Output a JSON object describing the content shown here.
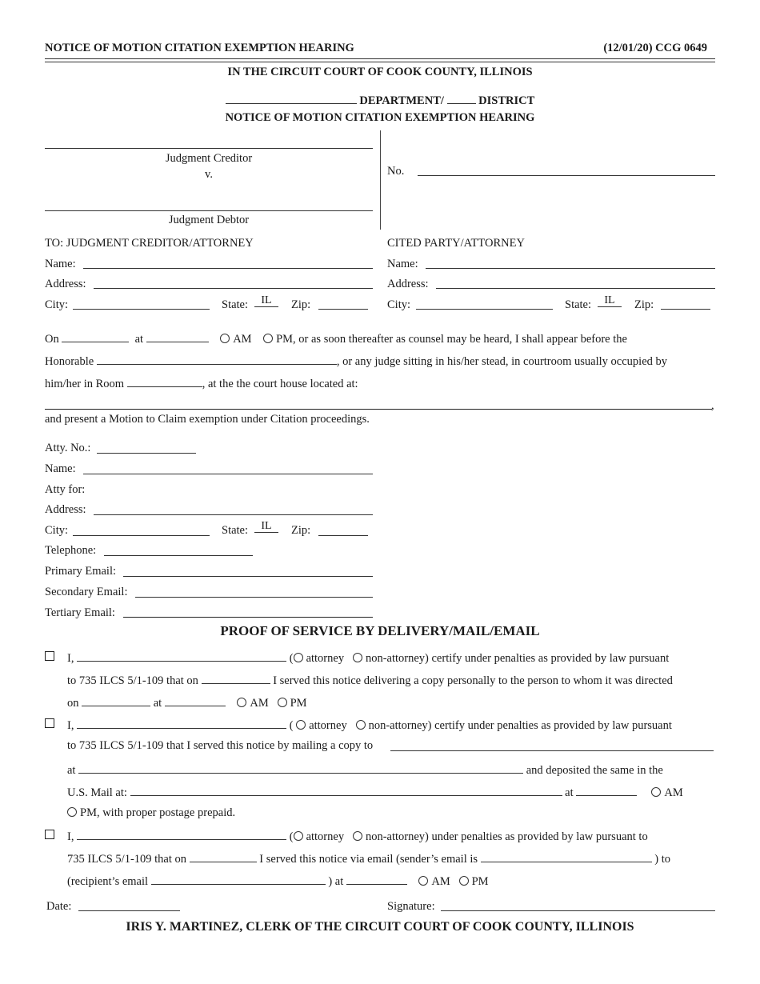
{
  "header": {
    "title_left": "NOTICE OF MOTION CITATION EXEMPTION HEARING",
    "title_right": "(12/01/20) CCG 0649"
  },
  "court": {
    "name": "IN THE CIRCUIT COURT OF COOK COUNTY, ILLINOIS",
    "department_label": "DEPARTMENT/",
    "district_label": "DISTRICT",
    "form_title": "NOTICE OF MOTION CITATION EXEMPTION HEARING"
  },
  "caption": {
    "creditor_label": "Judgment Creditor",
    "versus": "v.",
    "debtor_label": "Judgment Debtor",
    "case_no_label": "No.",
    "case_no_value": ""
  },
  "to_section": {
    "left_heading": "TO:  JUDGMENT CREDITOR/ATTORNEY",
    "right_heading": "CITED PARTY/ATTORNEY",
    "name_label": "Name:",
    "address_label": "Address:",
    "city_label": "City:",
    "state_label": "State:",
    "state_value": "IL",
    "zip_label": "Zip:"
  },
  "hearing": {
    "on_label": "On",
    "at_label": "at",
    "am_label": "AM",
    "pm_text": "PM, or as soon thereafter as counsel may be heard, I shall appear before the",
    "honorable_label": "Honorable",
    "honorable_suffix": ", or any judge sitting in his/her stead, in courtroom usually occupied by",
    "room_label": "him/her in Room",
    "room_suffix": ", at the the court house located at:",
    "address_suffix": ",",
    "motion_text": "and present a Motion to Claim exemption under Citation proceedings."
  },
  "attorney": {
    "atty_no_label": "Atty. No.:",
    "name_label": "Name:",
    "atty_for_label": "Atty for:",
    "address_label": "Address:",
    "city_label": "City:",
    "state_label": "State:",
    "state_value": "IL",
    "zip_label": "Zip:",
    "telephone_label": "Telephone:",
    "primary_email_label": "Primary Email:",
    "secondary_email_label": "Secondary Email:",
    "tertiary_email_label": "Tertiary Email:"
  },
  "proof": {
    "heading": "PROOF OF SERVICE BY DELIVERY/MAIL/EMAIL",
    "i_label": "I,",
    "attorney_label": "attorney",
    "non_attorney_label": "non-attorney)",
    "delivery": {
      "paren_open": "(",
      "certify_text": "certify under penalties as provided by law pursuant",
      "line2_prefix": "to 735 ILCS 5/1-109 that on",
      "line2_suffix": "I served this notice delivering a copy personally to the person to whom it was directed",
      "on_label": "on",
      "at_label": "at",
      "am_label": "AM",
      "pm_label": "PM"
    },
    "mail": {
      "paren_open": "(",
      "certify_text": "certify under penalties as provided by law pursuant",
      "line2_prefix": "to 735 ILCS 5/1-109 that I served this notice by mailing a copy to",
      "at_label": "at",
      "deposited_text": "and deposited the same in the",
      "usmail_label": "U.S. Mail at:",
      "at2_label": "at",
      "am_label": "AM",
      "pm_text": "PM, with proper postage prepaid."
    },
    "email": {
      "paren_open": "(",
      "certify_text": "under penalties as provided by law pursuant to",
      "line2_prefix": "735 ILCS 5/1-109 that on",
      "line2_mid": "I served this notice via email (sender’s email is",
      "line2_suffix": ") to",
      "recipient_label": "(recipient’s email",
      "at_label": ") at",
      "am_label": "AM",
      "pm_label": "PM"
    },
    "date_label": "Date:",
    "signature_label": "Signature:"
  },
  "footer": {
    "clerk": "IRIS Y. MARTINEZ, CLERK OF THE CIRCUIT COURT OF COOK COUNTY, ILLINOIS"
  }
}
